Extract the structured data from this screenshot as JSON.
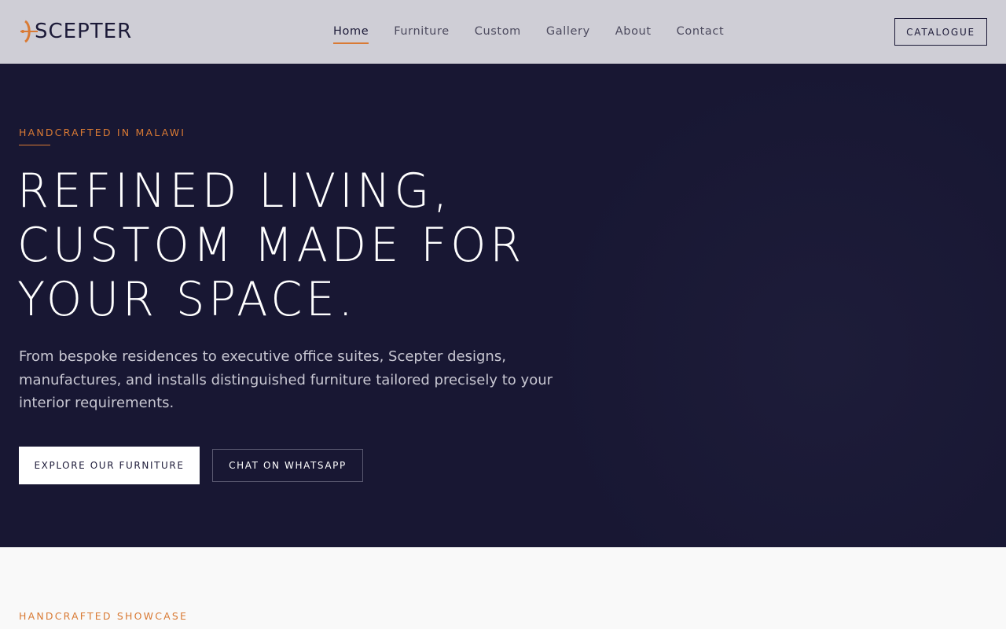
{
  "brand": {
    "logo_text": "SCEPTER",
    "accent_color": "#d97a34",
    "dark_color": "#181733",
    "logo_icon": "scepter-arrow-icon"
  },
  "nav": {
    "links": [
      {
        "label": "Home",
        "active": true
      },
      {
        "label": "Furniture",
        "active": false
      },
      {
        "label": "Custom",
        "active": false
      },
      {
        "label": "Gallery",
        "active": false
      },
      {
        "label": "About",
        "active": false
      },
      {
        "label": "Contact",
        "active": false
      }
    ],
    "catalogue_label": "CATALOGUE"
  },
  "hero": {
    "eyebrow": "HANDCRAFTED IN MALAWI",
    "headline_lines": [
      "REFINED LIVING,",
      "CUSTOM MADE FOR",
      "YOUR SPACE."
    ],
    "subtitle": "From bespoke residences to executive office suites, Scepter designs, manufactures, and installs distinguished furniture tailored precisely to your interior requirements.",
    "primary_button": "EXPLORE OUR FURNITURE",
    "secondary_button": "CHAT ON WHATSAPP"
  },
  "showcase": {
    "eyebrow": "HANDCRAFTED SHOWCASE"
  }
}
